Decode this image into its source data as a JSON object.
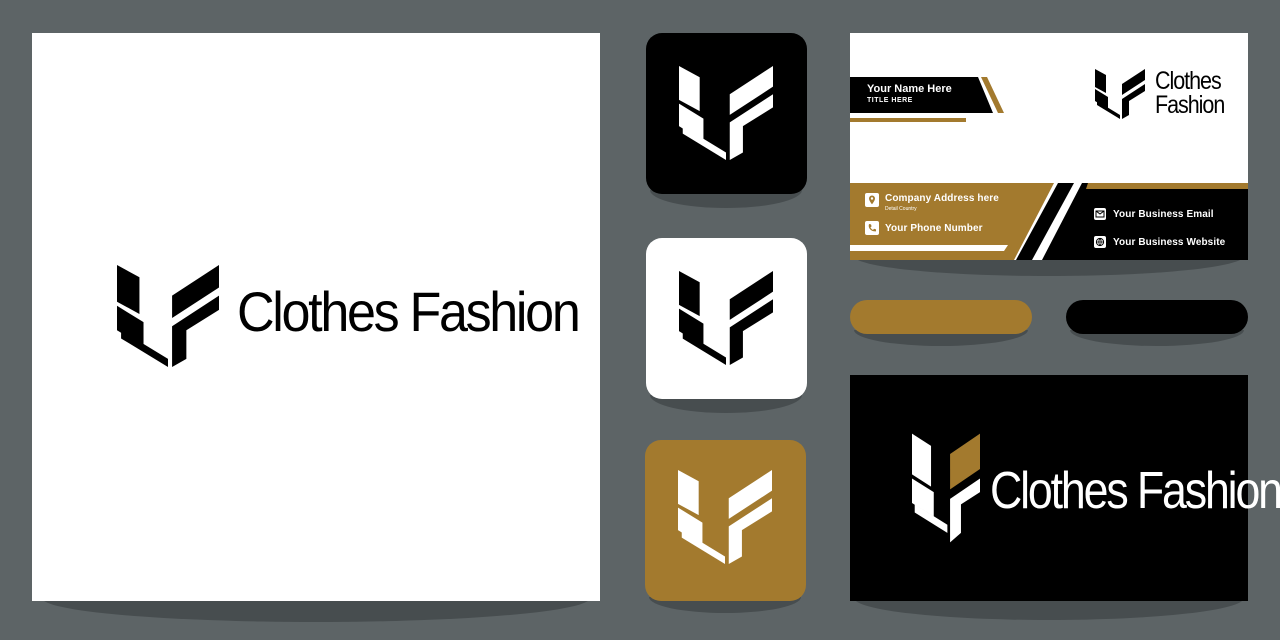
{
  "brand": {
    "name": "Clothes Fashion",
    "name_line1": "Clothes",
    "name_line2": "Fashion",
    "logo_icon": "cf-monogram-icon"
  },
  "colors": {
    "background": "#5d6466",
    "gold": "#a37a2e",
    "black": "#000000",
    "white": "#ffffff"
  },
  "business_card": {
    "name": "Your Name Here",
    "title": "TITLE HERE",
    "address": "Company Address here",
    "address_detail": "Detail Country",
    "phone": "Your Phone Number",
    "email": "Your Business Email",
    "website": "Your Business Website",
    "icons": [
      "location-pin-icon",
      "phone-icon",
      "email-icon",
      "globe-icon"
    ]
  }
}
